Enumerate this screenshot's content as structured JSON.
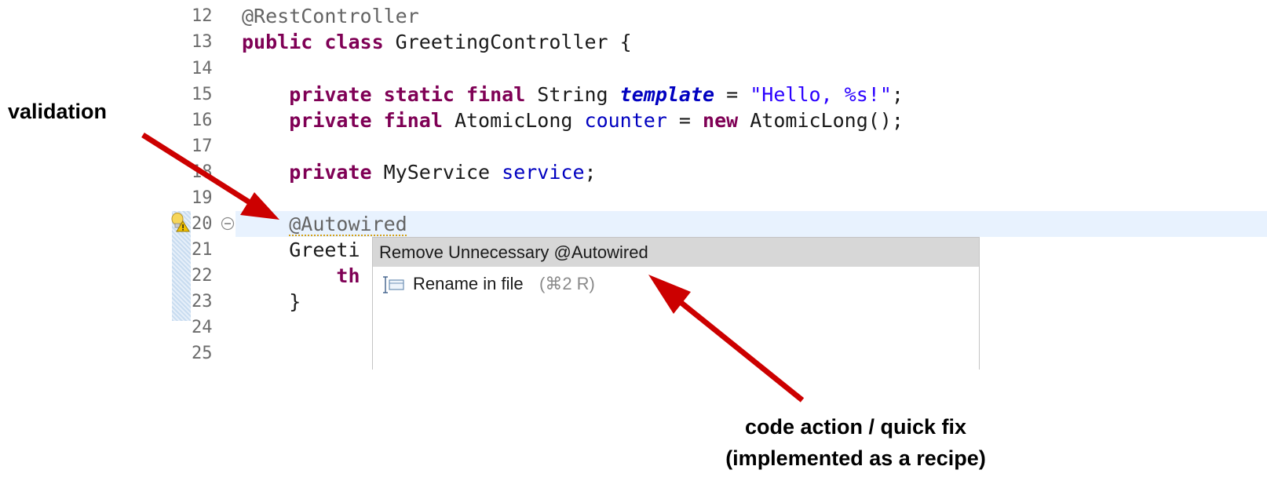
{
  "editor": {
    "lines": [
      {
        "num": "12"
      },
      {
        "num": "13"
      },
      {
        "num": "14"
      },
      {
        "num": "15"
      },
      {
        "num": "16"
      },
      {
        "num": "17"
      },
      {
        "num": "18"
      },
      {
        "num": "19"
      },
      {
        "num": "20"
      },
      {
        "num": "21"
      },
      {
        "num": "22"
      },
      {
        "num": "23"
      },
      {
        "num": "24"
      },
      {
        "num": "25"
      }
    ],
    "code": {
      "l12_anno": "@RestController",
      "l13_kw": "public class",
      "l13_rest": " GreetingController {",
      "l15_kw": "private static final",
      "l15_type": " String ",
      "l15_field": "template",
      "l15_eq": " = ",
      "l15_str": "\"Hello, %s!\"",
      "l15_end": ";",
      "l16_kw": "private final",
      "l16_type": " AtomicLong ",
      "l16_field": "counter",
      "l16_eq": " = ",
      "l16_new": "new",
      "l16_rest": " AtomicLong();",
      "l18_kw": "private",
      "l18_type": " MyService ",
      "l18_field": "service",
      "l18_end": ";",
      "l20_anno": "@Autowired",
      "l21_text": "Greeti",
      "l22_kw": "th",
      "l23_text": "}"
    },
    "gutter_icons": [
      "lightbulb-warning-icon",
      "fold-collapse-icon"
    ]
  },
  "quickfix_popup": {
    "selected_item": "Remove Unnecessary @Autowired",
    "item_label": "Rename in file",
    "item_shortcut": "(⌘2 R)",
    "item_icon": "rename-in-file-icon"
  },
  "annotations": {
    "validation_label": "validation",
    "quickfix_label_line1": "code action / quick fix",
    "quickfix_label_line2": "(implemented as a recipe)",
    "arrow_color": "#cc0000"
  }
}
